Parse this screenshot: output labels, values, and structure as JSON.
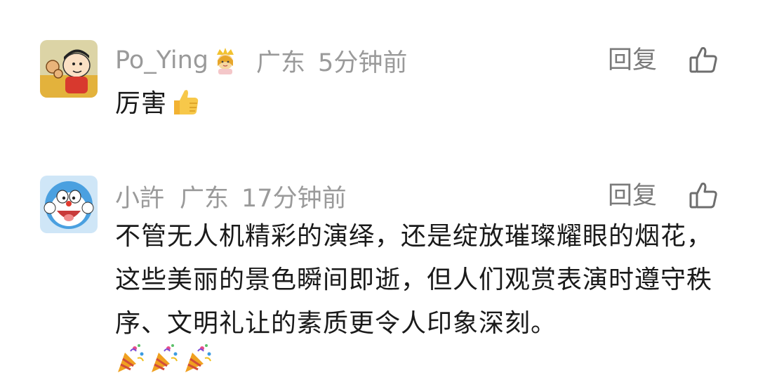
{
  "comments": [
    {
      "username": "Po_Ying",
      "badge_icon": "princess-crown-emoji",
      "location": "广东",
      "time": "5分钟前",
      "reply_label": "回复",
      "like_icon": "thumbs-up-outline-icon",
      "text": "厉害",
      "trailing_emoji": "thumbs-up-emoji"
    },
    {
      "username": "小許",
      "location": "广东",
      "time": "17分钟前",
      "reply_label": "回复",
      "like_icon": "thumbs-up-outline-icon",
      "text": "不管无人机精彩的演绎，还是绽放璀璨耀眼的烟花，这些美丽的景色瞬间即逝，但人们观赏表演时遵守秩序、文明礼让的素质更令人印象深刻。",
      "trailing_emojis": [
        "party-popper-emoji",
        "party-popper-emoji",
        "party-popper-emoji"
      ]
    }
  ],
  "colors": {
    "meta_text": "#9a9a9a",
    "body_text": "#1a1a1a",
    "reply_text": "#7a7a7a"
  }
}
